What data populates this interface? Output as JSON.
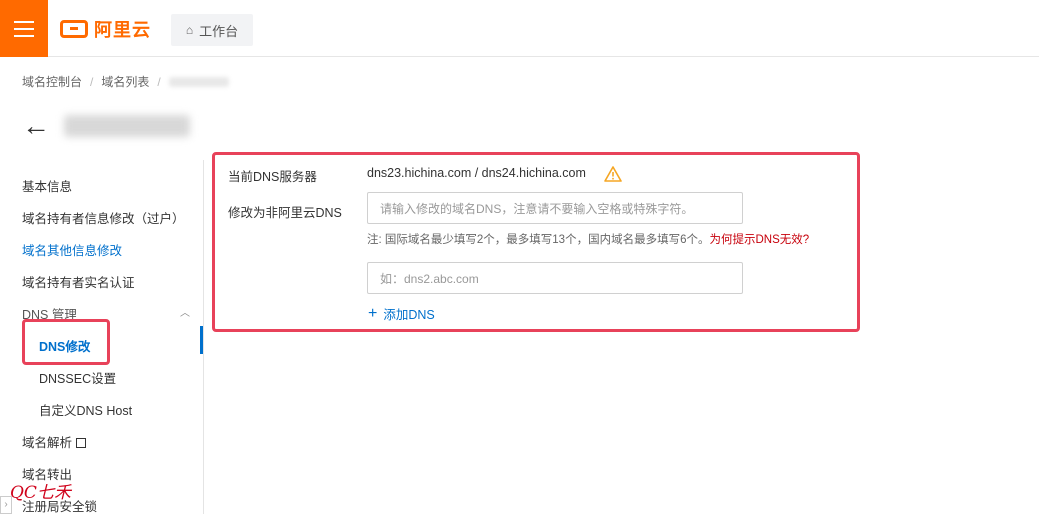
{
  "header": {
    "logo_text": "阿里云",
    "workbench_label": "工作台"
  },
  "breadcrumb": {
    "items": [
      "域名控制台",
      "域名列表"
    ]
  },
  "sidebar": {
    "items": [
      {
        "label": "基本信息"
      },
      {
        "label": "域名持有者信息修改（过户）"
      },
      {
        "label": "域名其他信息修改"
      },
      {
        "label": "域名持有者实名认证"
      },
      {
        "label": "DNS 管理"
      },
      {
        "label": "DNS修改"
      },
      {
        "label": "DNSSEC设置"
      },
      {
        "label": "自定义DNS Host"
      },
      {
        "label": "域名解析"
      },
      {
        "label": "域名转出"
      },
      {
        "label": "注册局安全锁"
      }
    ]
  },
  "dns_panel": {
    "current_label": "当前DNS服务器",
    "current_value": "dns23.hichina.com / dns24.hichina.com",
    "modify_label": "修改为非阿里云DNS",
    "input1_placeholder": "请输入修改的域名DNS，注意请不要输入空格或特殊字符。",
    "note_text": "注:   国际域名最少填写2个，最多填写13个，国内域名最多填写6个。",
    "note_link": "为何提示DNS无效?",
    "input2_placeholder": "如：dns2.abc.com",
    "add_dns_label": "添加DNS"
  },
  "watermark": "QC七禾",
  "colors": {
    "accent": "#ff6a00",
    "link": "#0070cc",
    "highlight": "#e8425a",
    "warning_link": "#c7000b"
  }
}
